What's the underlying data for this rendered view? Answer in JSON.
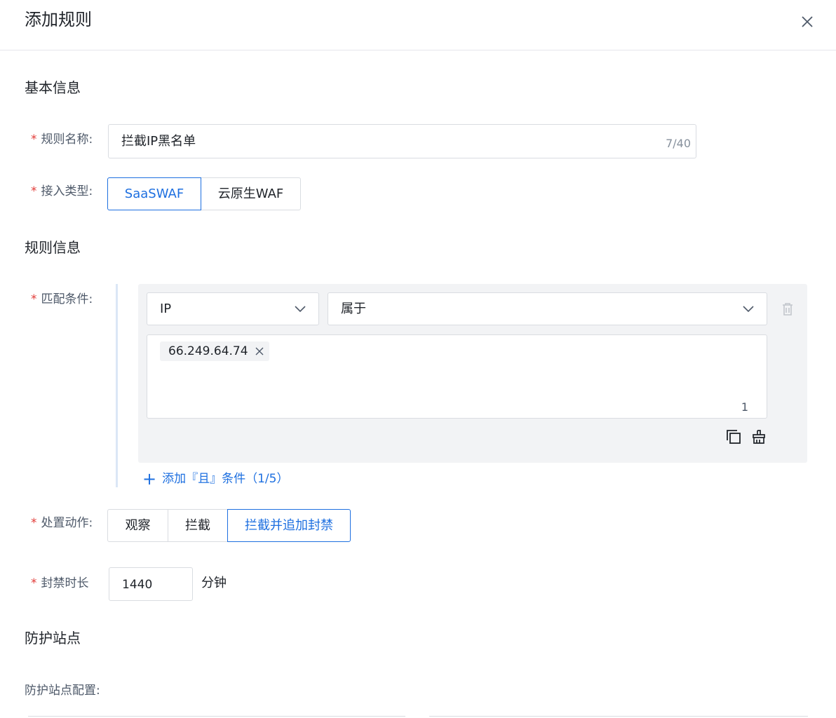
{
  "header": {
    "title": "添加规则"
  },
  "sections": {
    "basic": "基本信息",
    "rule": "规则信息",
    "protect": "防护站点"
  },
  "rule_name": {
    "label": "规则名称:",
    "value": "拦截IP黑名单",
    "count": "7/40"
  },
  "access_type": {
    "label": "接入类型:",
    "options": [
      "SaaSWAF",
      "云原生WAF"
    ],
    "selected": "SaaSWAF"
  },
  "match": {
    "label": "匹配条件:",
    "field": "IP",
    "operator": "属于",
    "tags": [
      "66.249.64.74"
    ],
    "tag_count": "1",
    "add_label": "添加『且』条件（1/5）"
  },
  "action": {
    "label": "处置动作:",
    "options": [
      "观察",
      "拦截",
      "拦截并追加封禁"
    ],
    "selected": "拦截并追加封禁"
  },
  "ban": {
    "label": "封禁时长",
    "value": "1440",
    "unit": "分钟"
  },
  "site_config": {
    "label": "防护站点配置:"
  },
  "colors": {
    "accent": "#1d6fe0",
    "required": "#e23c39",
    "border": "#d9dce1"
  }
}
